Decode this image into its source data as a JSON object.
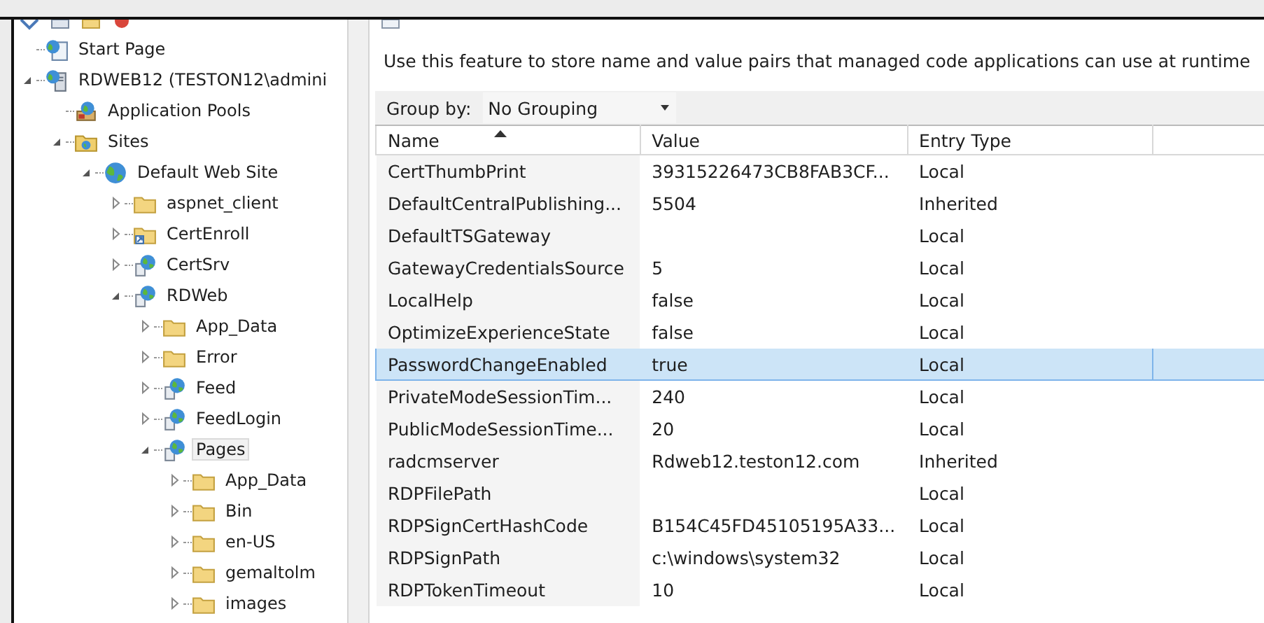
{
  "tree": [
    {
      "label": "Start Page",
      "kind": "start",
      "expandable": false,
      "selected": false
    },
    {
      "label": "RDWEB12 (TESTON12\\admini",
      "kind": "server",
      "expandable": true,
      "expanded": true,
      "selected": false,
      "children": [
        {
          "label": "Application Pools",
          "kind": "pool",
          "expandable": false,
          "selected": false
        },
        {
          "label": "Sites",
          "kind": "sites",
          "expandable": true,
          "expanded": true,
          "selected": false,
          "children": [
            {
              "label": "Default Web Site",
              "kind": "globe",
              "expandable": true,
              "expanded": true,
              "selected": false,
              "children": [
                {
                  "label": "aspnet_client",
                  "kind": "folder",
                  "expandable": true,
                  "expanded": false,
                  "selected": false
                },
                {
                  "label": "CertEnroll",
                  "kind": "shortcut",
                  "expandable": true,
                  "expanded": false,
                  "selected": false
                },
                {
                  "label": "CertSrv",
                  "kind": "app",
                  "expandable": true,
                  "expanded": false,
                  "selected": false
                },
                {
                  "label": "RDWeb",
                  "kind": "app",
                  "expandable": true,
                  "expanded": true,
                  "selected": false,
                  "children": [
                    {
                      "label": "App_Data",
                      "kind": "folder",
                      "expandable": true,
                      "expanded": false,
                      "selected": false
                    },
                    {
                      "label": "Error",
                      "kind": "folder",
                      "expandable": true,
                      "expanded": false,
                      "selected": false
                    },
                    {
                      "label": "Feed",
                      "kind": "app",
                      "expandable": true,
                      "expanded": false,
                      "selected": false
                    },
                    {
                      "label": "FeedLogin",
                      "kind": "app",
                      "expandable": true,
                      "expanded": false,
                      "selected": false
                    },
                    {
                      "label": "Pages",
                      "kind": "app",
                      "expandable": true,
                      "expanded": true,
                      "selected": true,
                      "children": [
                        {
                          "label": "App_Data",
                          "kind": "folder",
                          "expandable": true,
                          "expanded": false,
                          "selected": false
                        },
                        {
                          "label": "Bin",
                          "kind": "folder",
                          "expandable": true,
                          "expanded": false,
                          "selected": false
                        },
                        {
                          "label": "en-US",
                          "kind": "folder",
                          "expandable": true,
                          "expanded": false,
                          "selected": false
                        },
                        {
                          "label": "gemaltolm",
                          "kind": "folder",
                          "expandable": true,
                          "expanded": false,
                          "selected": false
                        },
                        {
                          "label": "images",
                          "kind": "folder",
                          "expandable": true,
                          "expanded": false,
                          "selected": false
                        }
                      ]
                    }
                  ]
                }
              ]
            }
          ]
        }
      ]
    }
  ],
  "description": "Use this feature to store name and value pairs that managed code applications can use at runtime",
  "group_by": {
    "label": "Group by:",
    "value": "No Grouping"
  },
  "table": {
    "columns": [
      {
        "label": "Name",
        "sorted": true
      },
      {
        "label": "Value",
        "sorted": false
      },
      {
        "label": "Entry Type",
        "sorted": false
      }
    ],
    "rows": [
      {
        "name": "CertThumbPrint",
        "value": "39315226473CB8FAB3CF...",
        "entry_type": "Local",
        "selected": false
      },
      {
        "name": "DefaultCentralPublishing...",
        "value": "5504",
        "entry_type": "Inherited",
        "selected": false
      },
      {
        "name": "DefaultTSGateway",
        "entry_type": "Local",
        "selected": false
      },
      {
        "name": "GatewayCredentialsSource",
        "value": "5",
        "entry_type": "Local",
        "selected": false
      },
      {
        "name": "LocalHelp",
        "value": "false",
        "entry_type": "Local",
        "selected": false
      },
      {
        "name": "OptimizeExperienceState",
        "value": "false",
        "entry_type": "Local",
        "selected": false
      },
      {
        "name": "PasswordChangeEnabled",
        "value": "true",
        "entry_type": "Local",
        "selected": true
      },
      {
        "name": "PrivateModeSessionTim...",
        "value": "240",
        "entry_type": "Local",
        "selected": false
      },
      {
        "name": "PublicModeSessionTime...",
        "value": "20",
        "entry_type": "Local",
        "selected": false
      },
      {
        "name": "radcmserver",
        "value": "Rdweb12.teston12.com",
        "entry_type": "Inherited",
        "selected": false
      },
      {
        "name": "RDPFilePath",
        "entry_type": "Local",
        "selected": false
      },
      {
        "name": "RDPSignCertHashCode",
        "value": "B154C45FD45105195A33...",
        "entry_type": "Local",
        "selected": false
      },
      {
        "name": "RDPSignPath",
        "value": "c:\\windows\\system32",
        "entry_type": "Local",
        "selected": false
      },
      {
        "name": "RDPTokenTimeout",
        "value": "10",
        "entry_type": "Local",
        "selected": false
      }
    ]
  }
}
